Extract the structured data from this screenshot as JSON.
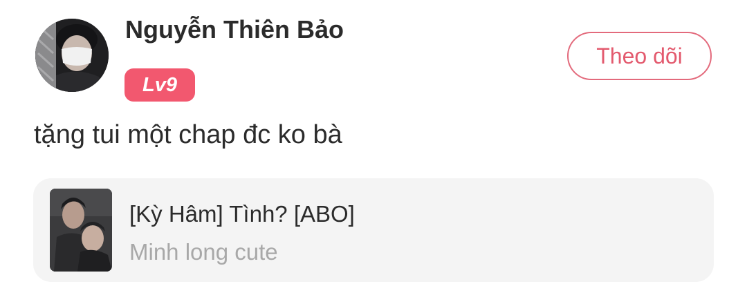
{
  "user": {
    "name": "Nguyễn Thiên Bảo",
    "level": "Lv9"
  },
  "follow_button": {
    "label": "Theo dõi"
  },
  "comment": {
    "text": "tặng tui một chap đc ko bà"
  },
  "story": {
    "title": "[Kỳ Hâm] Tình? [ABO]",
    "author": "Minh long cute"
  },
  "colors": {
    "badge": "#f2586f",
    "follow_accent": "#e35a6e",
    "card_background": "#f4f4f4"
  }
}
